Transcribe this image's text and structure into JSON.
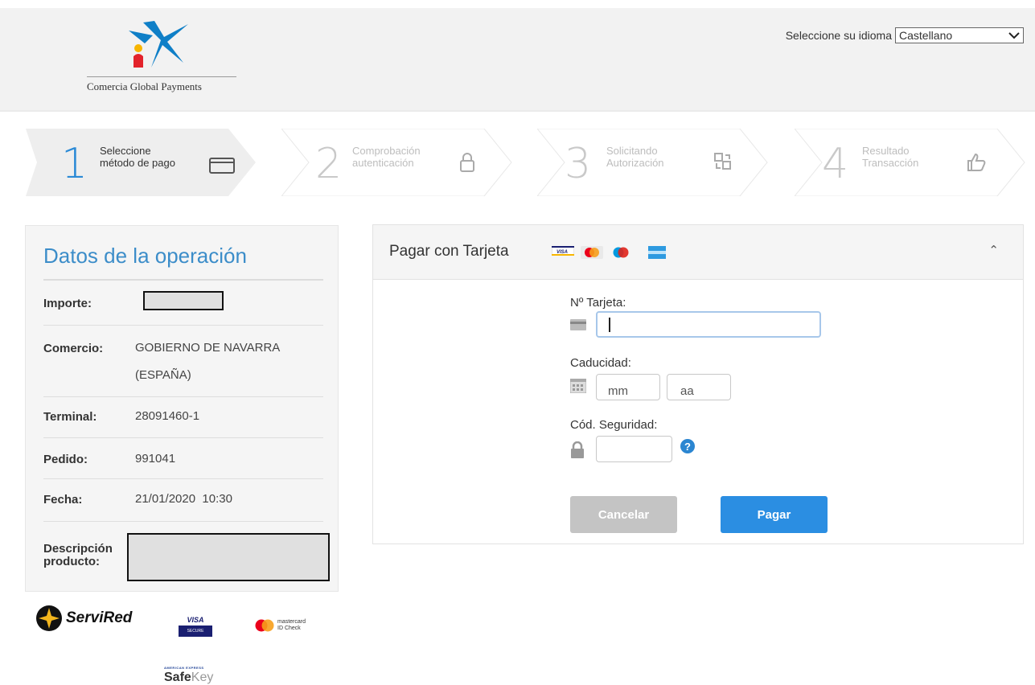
{
  "header": {
    "brand_text": "Comercia Global Payments",
    "language_label": "Seleccione su idioma",
    "language_selected": "Castellano",
    "accent": "#0f7fc7"
  },
  "steps": [
    {
      "number": "1",
      "line1": "Seleccione",
      "line2": "método de pago",
      "icon": "card-icon",
      "state": "active"
    },
    {
      "number": "2",
      "line1": "Comprobación",
      "line2": "autenticación",
      "icon": "lock-icon",
      "state": "inactive"
    },
    {
      "number": "3",
      "line1": "Solicitando",
      "line2": "Autorización",
      "icon": "transfer-icon",
      "state": "inactive"
    },
    {
      "number": "4",
      "line1": "Resultado",
      "line2": "Transacción",
      "icon": "thumbs-up-icon",
      "state": "inactive"
    }
  ],
  "operation": {
    "title": "Datos de la operación",
    "importe_label": "Importe:",
    "comercio_label": "Comercio:",
    "comercio_value_1": "GOBIERNO DE NAVARRA",
    "comercio_value_2": "(ESPAÑA)",
    "terminal_label": "Terminal:",
    "terminal_value": "28091460-1",
    "pedido_label": "Pedido:",
    "pedido_value": "991041",
    "fecha_label": "Fecha:",
    "fecha_value": "21/01/2020  10:30",
    "descripcion_label_1": "Descripción",
    "descripcion_label_2": "producto:"
  },
  "secure_logos": {
    "servired": "ServiRed",
    "visa_top": "VISA",
    "visa_bottom": "SECURE",
    "mastercard_1": "mastercard",
    "mastercard_2": "ID Check",
    "amex_top": "AMERICAN EXPRESS",
    "amex_main": "Safe",
    "amex_main_2": "Key"
  },
  "payment": {
    "title": "Pagar con Tarjeta",
    "card_number_label": "Nº Tarjeta:",
    "card_number_value": "",
    "expiry_label": "Caducidad:",
    "month_placeholder": "mm",
    "year_placeholder": "aa",
    "cvv_label": "Cód. Seguridad:",
    "cancel_label": "Cancelar",
    "pay_label": "Pagar",
    "pay_color": "#2b8ee2",
    "cancel_color": "#c4c4c4"
  }
}
